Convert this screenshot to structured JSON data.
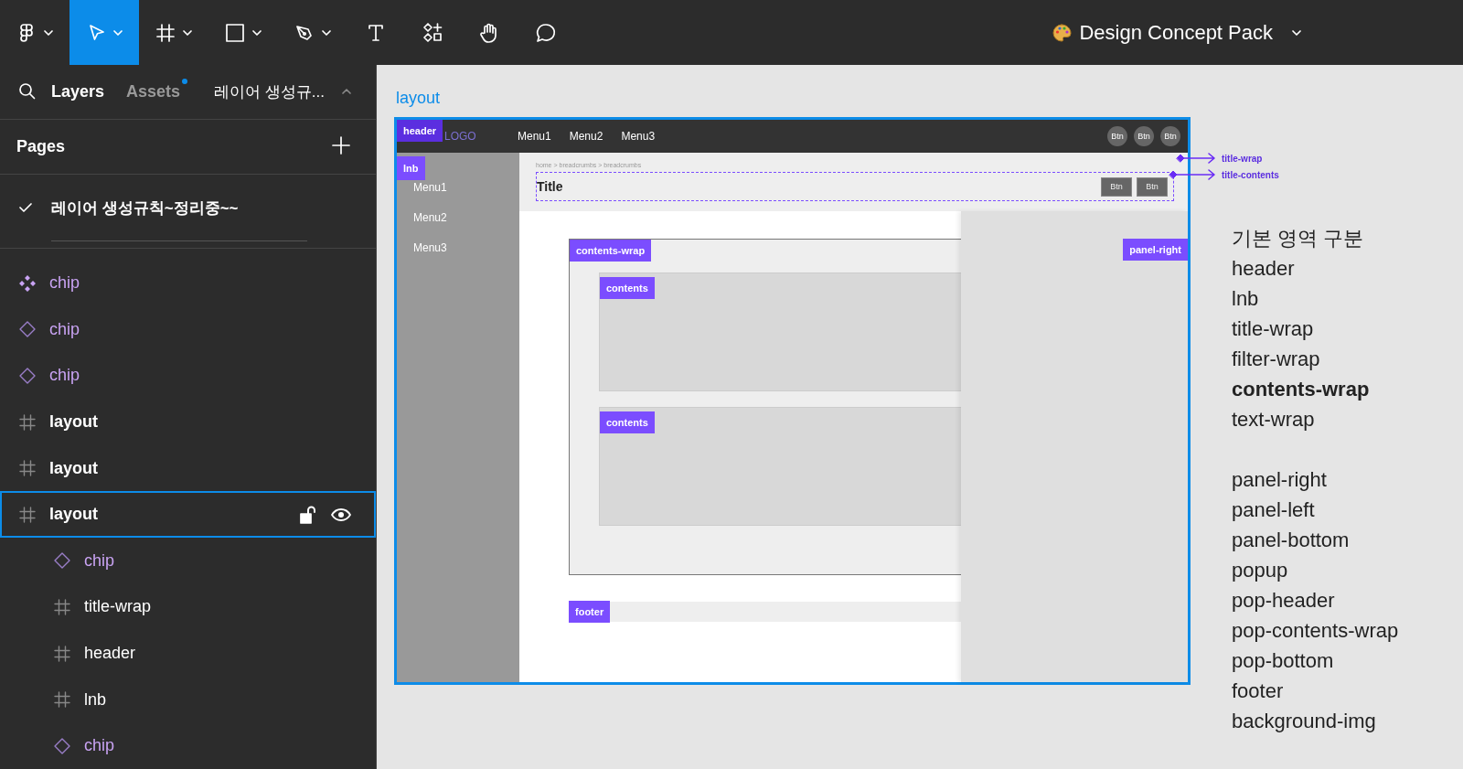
{
  "toolbar": {
    "tools": [
      {
        "kind": "main-menu",
        "dropdown": true,
        "selected": false
      },
      {
        "kind": "move",
        "dropdown": true,
        "selected": true
      },
      {
        "kind": "frame",
        "dropdown": true,
        "selected": false
      },
      {
        "kind": "rectangle",
        "dropdown": true,
        "selected": false
      },
      {
        "kind": "pen",
        "dropdown": true,
        "selected": false
      },
      {
        "kind": "text",
        "dropdown": false,
        "selected": false
      },
      {
        "kind": "resources",
        "dropdown": false,
        "selected": false
      },
      {
        "kind": "hand",
        "dropdown": false,
        "selected": false
      },
      {
        "kind": "comment",
        "dropdown": false,
        "selected": false
      }
    ],
    "file_title": "Design Concept Pack"
  },
  "layers_panel": {
    "tabs": [
      {
        "label": "Layers",
        "selected": true,
        "badge": false
      },
      {
        "label": "Assets",
        "selected": false,
        "badge": true
      }
    ],
    "page_selector": "레이어 생성규...",
    "pages_heading": "Pages",
    "pages": [
      {
        "name": "레이어 생성규칙~정리중~~",
        "selected": true
      }
    ],
    "layers": [
      {
        "name": "chip",
        "kind": "component-set",
        "selected": false
      },
      {
        "name": "chip",
        "kind": "instance",
        "selected": false
      },
      {
        "name": "chip",
        "kind": "instance",
        "selected": false
      },
      {
        "name": "layout",
        "kind": "frame",
        "selected": false
      },
      {
        "name": "layout",
        "kind": "frame",
        "selected": false
      },
      {
        "name": "layout",
        "kind": "frame",
        "selected": true,
        "children": [
          {
            "name": "chip",
            "kind": "instance",
            "selected": false
          },
          {
            "name": "title-wrap",
            "kind": "frame",
            "selected": false
          },
          {
            "name": "header",
            "kind": "frame",
            "selected": false
          },
          {
            "name": "lnb",
            "kind": "frame",
            "selected": false
          },
          {
            "name": "chip",
            "kind": "instance",
            "selected": false
          }
        ]
      }
    ]
  },
  "canvas": {
    "frame_label": "layout",
    "mockup": {
      "header": {
        "tag": "header",
        "logo": "LOGO",
        "menus": [
          "Menu1",
          "Menu2",
          "Menu3"
        ],
        "buttons": [
          "Btn",
          "Btn",
          "Btn"
        ]
      },
      "lnb": {
        "tag": "lnb",
        "menus": [
          "Menu1",
          "Menu2",
          "Menu3"
        ]
      },
      "title_wrap": {
        "breadcrumb": "home > breadcrumbs > breadcrumbs",
        "title": "Title",
        "buttons": [
          "Btn",
          "Btn"
        ]
      },
      "contents_wrap": {
        "tag": "contents-wrap",
        "contents": [
          {
            "tag": "contents"
          },
          {
            "tag": "contents"
          }
        ]
      },
      "footer": {
        "tag": "footer"
      },
      "panel_right": {
        "tag": "panel-right"
      }
    },
    "annotations": [
      "title-wrap",
      "title-contents"
    ],
    "notes": [
      [
        {
          "text": "기본 영역 구분",
          "bold": false
        },
        {
          "text": "header",
          "bold": false
        },
        {
          "text": "lnb",
          "bold": false
        },
        {
          "text": "title-wrap",
          "bold": false
        },
        {
          "text": "filter-wrap",
          "bold": false
        },
        {
          "text": "contents-wrap",
          "bold": true
        },
        {
          "text": "text-wrap",
          "bold": false
        }
      ],
      [
        {
          "text": "panel-right",
          "bold": false
        },
        {
          "text": "panel-left",
          "bold": false
        },
        {
          "text": "panel-bottom",
          "bold": false
        },
        {
          "text": "popup",
          "bold": false
        },
        {
          "text": "pop-header",
          "bold": false
        },
        {
          "text": "pop-contents-wrap",
          "bold": false
        },
        {
          "text": "pop-bottom",
          "bold": false
        },
        {
          "text": "footer",
          "bold": false
        },
        {
          "text": "background-img",
          "bold": false
        }
      ]
    ]
  }
}
